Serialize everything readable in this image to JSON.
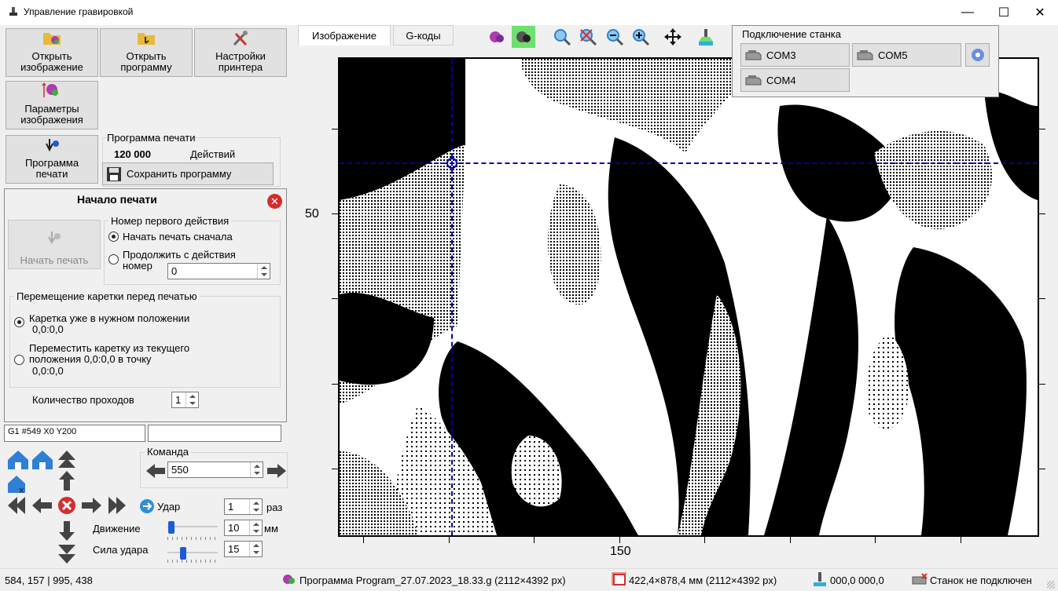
{
  "window": {
    "title": "Управление гравировкой",
    "minimize": "—",
    "maximize": "☐",
    "close": "✕"
  },
  "toolbar_left": {
    "open_image": "Открыть\nизображение",
    "open_program": "Открыть\nпрограмму",
    "printer_settings": "Настройки\nпринтера",
    "image_params": "Параметры\nизображения",
    "print_program": "Программа\nпечати"
  },
  "print_program": {
    "group_title": "Программа печати",
    "count": "120 000",
    "count_label": "Действий",
    "save_button": "Сохранить программу"
  },
  "start_panel": {
    "title": "Начало печати",
    "start_button": "Начать печать",
    "first_action_group": "Номер первого действия",
    "radio_from_start": "Начать печать сначала",
    "radio_continue": "Продолжить с действия\nномер",
    "continue_value": "0",
    "carriage_group": "Перемещение каретки перед печатью",
    "radio_in_position": "Каретка уже в нужном положении",
    "in_position_coords": "0,0:0,0",
    "radio_move": "Переместить каретку из текущего\nположения 0,0:0,0 в точку",
    "move_coords": "0,0:0,0",
    "passes_label": "Количество проходов",
    "passes_value": "1"
  },
  "command_line": {
    "value": "G1 #549 X0 Y200",
    "second_value": ""
  },
  "command_group": {
    "title": "Команда",
    "value": "550"
  },
  "motion": {
    "hit_label": "Удар",
    "hit_value": "1",
    "hit_unit": "раз",
    "move_label": "Движение",
    "move_value": "10",
    "move_unit": "мм",
    "force_label": "Сила удара",
    "force_value": "15"
  },
  "tabs": [
    {
      "label": "Изображение",
      "active": true
    },
    {
      "label": "G-коды",
      "active": false
    }
  ],
  "connection": {
    "title": "Подключение станка",
    "ports": [
      "COM3",
      "COM5",
      "COM4"
    ]
  },
  "canvas": {
    "y_label": "50",
    "x_label": "150"
  },
  "status": {
    "coords": "584, 157  |  995, 438",
    "program": "Программа Program_27.07.2023_18.33.g (2112×4392 px)",
    "size": "422,4×878,4 мм (2112×4392 px)",
    "position": "000,0  000,0",
    "machine": "Станок не подключен"
  },
  "colors": {
    "accent_blue": "#1e5bd8",
    "crosshair": "#0000aa",
    "close_red": "#d32f2f"
  }
}
